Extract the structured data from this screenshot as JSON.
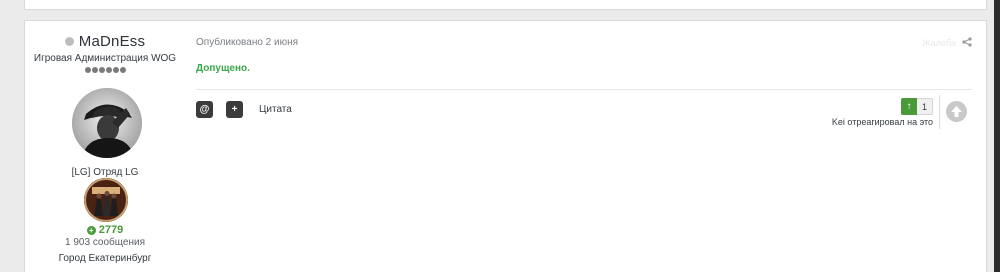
{
  "author": {
    "name": "MaDnEss",
    "group": "Игровая Администрация WOG",
    "squad": "[LG] Отряд LG",
    "reputation": "2779",
    "posts": "1 903 сообщения",
    "city": "Город Екатеринбург",
    "rank_pips": 6
  },
  "post": {
    "published": "Опубликовано 2 июня",
    "body": "Допущено.",
    "report_label": "Жалоба"
  },
  "tools": {
    "mention_glyph": "@",
    "multiquote_glyph": "+",
    "quote_label": "Цитата"
  },
  "reactions": {
    "count": "1",
    "reacted_text": "Kei отреагировал на это"
  },
  "colors": {
    "accent_green": "#4a9a3a",
    "approved_green": "#3aa84a",
    "button_dark": "#3b3b3b"
  }
}
